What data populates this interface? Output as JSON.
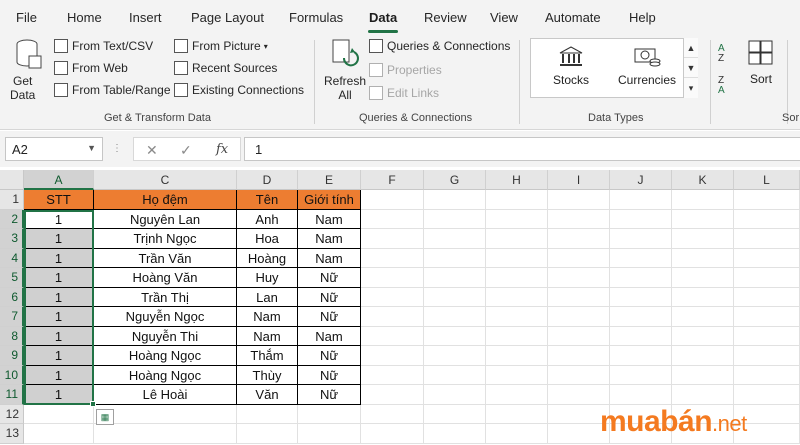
{
  "menu": {
    "tabs": [
      "File",
      "Home",
      "Insert",
      "Page Layout",
      "Formulas",
      "Data",
      "Review",
      "View",
      "Automate",
      "Help"
    ],
    "active": "Data"
  },
  "ribbon": {
    "get_transform": {
      "get_data_label": "Get\nData",
      "from_text_csv": "From Text/CSV",
      "from_web": "From Web",
      "from_table_range": "From Table/Range",
      "from_picture": "From Picture",
      "recent_sources": "Recent Sources",
      "existing_connections": "Existing Connections",
      "group_label": "Get & Transform Data"
    },
    "queries": {
      "refresh_all": "Refresh\nAll",
      "queries_connections": "Queries & Connections",
      "properties": "Properties",
      "edit_links": "Edit Links",
      "group_label": "Queries & Connections"
    },
    "data_types": {
      "stocks": "Stocks",
      "currencies": "Currencies",
      "group_label": "Data Types"
    },
    "sort": {
      "sort_label": "Sort",
      "group_label": "Sor"
    }
  },
  "formula_bar": {
    "name_box": "A2",
    "value": "1"
  },
  "columns": [
    "A",
    "C",
    "D",
    "E",
    "F",
    "G",
    "H",
    "I",
    "J",
    "K",
    "L"
  ],
  "rows": [
    "1",
    "2",
    "3",
    "4",
    "5",
    "6",
    "7",
    "8",
    "9",
    "10",
    "11",
    "12",
    "13"
  ],
  "table": {
    "headers": [
      "STT",
      "Họ đệm",
      "Tên",
      "Giới tính"
    ],
    "rows": [
      [
        "1",
        "Nguyên Lan",
        "Anh",
        "Nam"
      ],
      [
        "1",
        "Trịnh Ngọc",
        "Hoa",
        "Nam"
      ],
      [
        "1",
        "Trần Văn",
        "Hoàng",
        "Nam"
      ],
      [
        "1",
        "Hoàng Văn",
        "Huy",
        "Nữ"
      ],
      [
        "1",
        "Trần Thị",
        "Lan",
        "Nữ"
      ],
      [
        "1",
        "Nguyễn Ngọc",
        "Nam",
        "Nữ"
      ],
      [
        "1",
        "Nguyễn Thi",
        "Nam",
        "Nam"
      ],
      [
        "1",
        "Hoàng Ngọc",
        "Thắm",
        "Nữ"
      ],
      [
        "1",
        "Hoàng Ngọc",
        "Thùy",
        "Nữ"
      ],
      [
        "1",
        "Lê Hoài",
        "Văn",
        "Nữ"
      ]
    ]
  },
  "watermark": {
    "main": "muabán",
    "suffix": ".net"
  },
  "colors": {
    "accent": "#217346",
    "header_fill": "#ed7d31",
    "watermark": "#f47a20"
  }
}
